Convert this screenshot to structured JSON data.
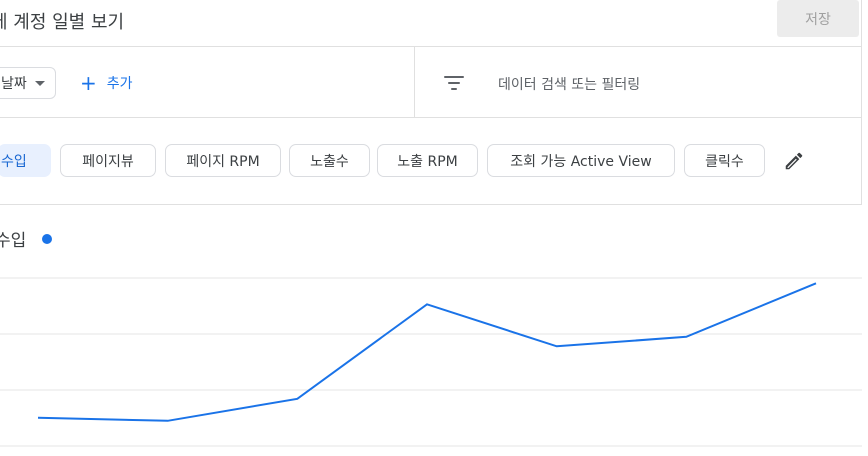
{
  "header": {
    "title": "체 계정 일별 보기",
    "save_label": "저장"
  },
  "toolbar": {
    "date_dimension_label": "날짜",
    "add_label": "추가",
    "filter_placeholder": "데이터 검색 또는 필터링"
  },
  "metrics": {
    "chips": [
      {
        "label": "수입",
        "active": true
      },
      {
        "label": "페이지뷰",
        "active": false
      },
      {
        "label": "페이지 RPM",
        "active": false
      },
      {
        "label": "노출수",
        "active": false
      },
      {
        "label": "노출 RPM",
        "active": false
      },
      {
        "label": "조회 가능 Active View",
        "active": false
      },
      {
        "label": "클릭수",
        "active": false
      }
    ],
    "edit_icon": "pencil-icon"
  },
  "chart_data": {
    "type": "line",
    "title": "수입",
    "series": [
      {
        "name": "수입",
        "color": "#1a73e8",
        "values": [
          0.27,
          0.24,
          0.45,
          1.35,
          0.95,
          1.04,
          1.55
        ]
      }
    ],
    "ylim": [
      0,
      1.6
    ],
    "grid": true,
    "legend": "inline-dot"
  },
  "colors": {
    "accent": "#1a73e8",
    "active_chip_bg": "#e8f0fe",
    "divider": "#e0e0e0"
  }
}
